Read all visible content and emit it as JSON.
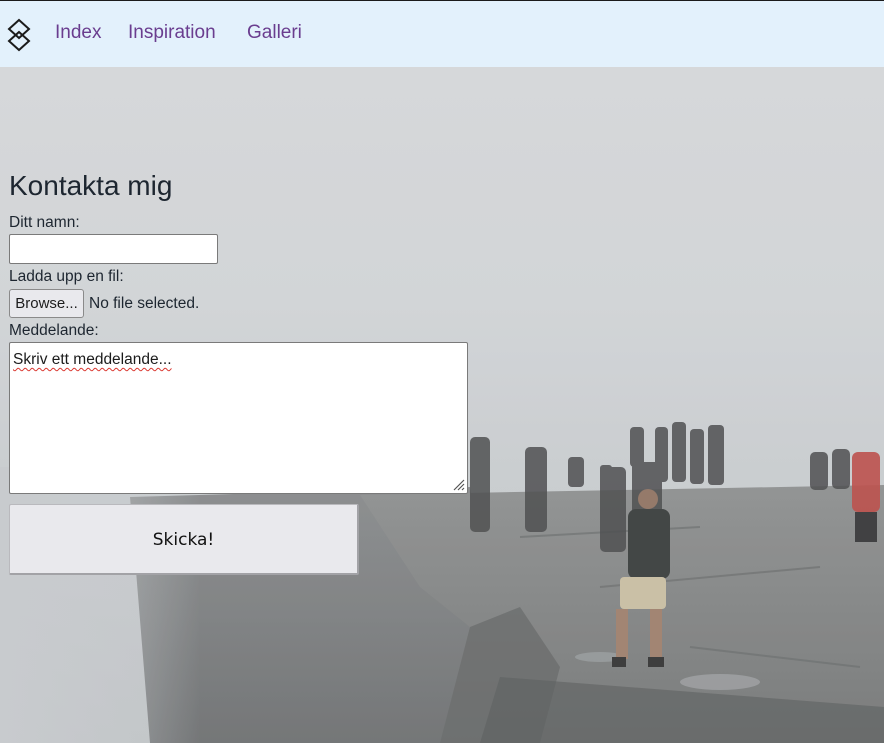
{
  "nav": {
    "logo_icon": "diamond-logo-icon",
    "links": [
      {
        "label": "Index"
      },
      {
        "label": "Inspiration"
      },
      {
        "label": "Galleri"
      }
    ],
    "link_color": "#6a3d8f",
    "bar_color": "#e3f1fc"
  },
  "form": {
    "title": "Kontakta mig",
    "name_label": "Ditt namn:",
    "name_value": "",
    "file_label": "Ladda upp en fil:",
    "browse_label": "Browse...",
    "file_status": "No file selected.",
    "message_label": "Meddelande:",
    "message_value": "Skriv ett meddelande...",
    "submit_label": "Skicka!"
  },
  "background": {
    "description_icon": "foggy-cliff-photo"
  }
}
